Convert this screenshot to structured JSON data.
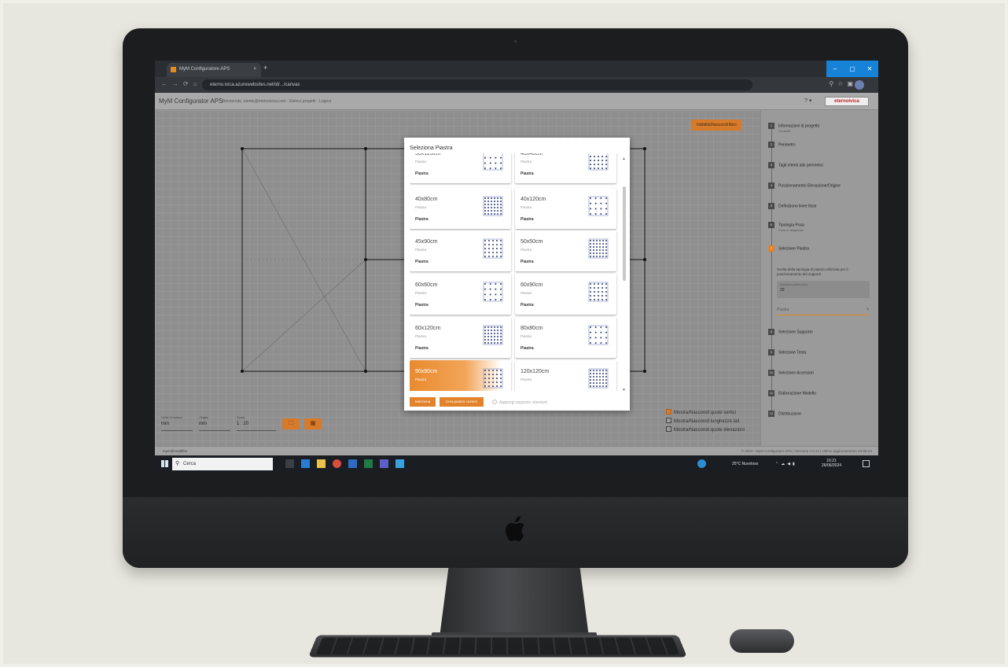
{
  "browser": {
    "tab_title": "MyM Configuratore APS",
    "tab_close": "×",
    "new_tab": "+",
    "url": "eterno.ivica.azurewebsites.net/id/.../canvas",
    "window_controls": [
      "–",
      "▢",
      "✕"
    ]
  },
  "app": {
    "name": "MyM Configurator APS",
    "subtitle": "Benvenuto, utente@eternoivica.com · Elenco progetti · Logout",
    "help": "? ▾",
    "brand": "eternoivica"
  },
  "canvas": {
    "visibility_button": "Visibilità/Nascondi libro",
    "checkboxes": [
      {
        "label": "Mostra/Nascondi quote vertici",
        "checked": true
      },
      {
        "label": "Mostra/Nascondi lunghezze lati",
        "checked": false
      },
      {
        "label": "Mostra/Nascondi quote elevazioni",
        "checked": false
      }
    ],
    "controls": {
      "unit_label": "Unità di misura",
      "unit_value": "mm",
      "grid_label": "Griglia",
      "grid_value": "mm",
      "scale_label": "Scala",
      "scale_value": "1 : 20"
    }
  },
  "modal": {
    "title": "Seleziona Piastra",
    "tiles": [
      {
        "name": "30x120cm",
        "type": "Piastra",
        "footer": "Piastra"
      },
      {
        "name": "40x40cm",
        "type": "Piastra",
        "footer": "Piastra"
      },
      {
        "name": "40x80cm",
        "type": "Piastra",
        "footer": "Piastra"
      },
      {
        "name": "40x120cm",
        "type": "Piastra",
        "footer": "Piastra"
      },
      {
        "name": "45x90cm",
        "type": "Piastra",
        "footer": "Piastra"
      },
      {
        "name": "50x50cm",
        "type": "Piastra",
        "footer": "Piastra"
      },
      {
        "name": "60x60cm",
        "type": "Piastra",
        "footer": "Piastra"
      },
      {
        "name": "60x90cm",
        "type": "Piastra",
        "footer": "Piastra"
      },
      {
        "name": "60x120cm",
        "type": "Piastra",
        "footer": "Piastra"
      },
      {
        "name": "80x80cm",
        "type": "Piastra",
        "footer": "Piastra"
      },
      {
        "name": "90x90cm",
        "type": "Piastra",
        "footer": "",
        "selected": true
      },
      {
        "name": "120x120cm",
        "type": "Piastra",
        "footer": ""
      }
    ],
    "select_button": "Seleziona",
    "custom_button": "Crea piastra custom",
    "add_custom": "Aggiungi supporto standard"
  },
  "steps": [
    {
      "num": "1",
      "label": "Informazioni di progetto",
      "sub": "Generali"
    },
    {
      "num": "2",
      "label": "Perimetro",
      "sub": ""
    },
    {
      "num": "3",
      "label": "Tagli interni allo perimetro",
      "sub": ""
    },
    {
      "num": "4",
      "label": "Posizionamento Elevazione/Origine",
      "sub": ""
    },
    {
      "num": "5",
      "label": "Definizione linee fisse",
      "sub": ""
    },
    {
      "num": "6",
      "label": "Tipologia Posa",
      "sub": "Posa in diagonale"
    },
    {
      "num": "7",
      "label": "Selezione Piastra",
      "sub": "",
      "active": true
    },
    {
      "num": "8",
      "label": "Selezione Supporto",
      "sub": ""
    },
    {
      "num": "9",
      "label": "Selezione Testa",
      "sub": ""
    },
    {
      "num": "10",
      "label": "Selezione Accessori",
      "sub": ""
    },
    {
      "num": "11",
      "label": "Elaborazione Modello",
      "sub": ""
    },
    {
      "num": "12",
      "label": "Distribuzione",
      "sub": ""
    }
  ],
  "active_step": {
    "description": "Scelta della tipologia di piastra utilizzata per il posizionamento dei supporti",
    "input_label": "Spessore piastra (mm)",
    "input_value": "20",
    "piastra_label": "Piastra"
  },
  "footer": {
    "left": "mym@mediflex",
    "right": "© 2024 - MyM Configurator APS | Versione 4.0.12 | Ultimo aggiornamento 24-06-24"
  },
  "taskbar": {
    "search": "Cerca",
    "weather": "25°C Nuvoloso",
    "time": "16:21",
    "date": "26/06/2024"
  }
}
